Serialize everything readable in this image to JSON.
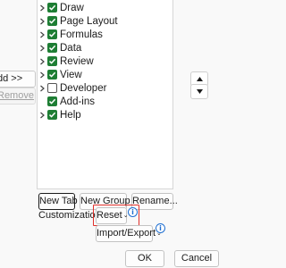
{
  "side_buttons": {
    "add_label": "dd >>",
    "remove_label": "Remove"
  },
  "tree": {
    "items": [
      {
        "label": "Draw",
        "checked": true,
        "expandable": true
      },
      {
        "label": "Page Layout",
        "checked": true,
        "expandable": true
      },
      {
        "label": "Formulas",
        "checked": true,
        "expandable": true
      },
      {
        "label": "Data",
        "checked": true,
        "expandable": true
      },
      {
        "label": "Review",
        "checked": true,
        "expandable": true
      },
      {
        "label": "View",
        "checked": true,
        "expandable": true
      },
      {
        "label": "Developer",
        "checked": false,
        "expandable": true
      },
      {
        "label": "Add-ins",
        "checked": true,
        "expandable": false
      },
      {
        "label": "Help",
        "checked": true,
        "expandable": true
      }
    ]
  },
  "buttons": {
    "new_tab": "New Tab",
    "new_group": "New Group",
    "rename": "Rename...",
    "reset": "Reset",
    "import_export": "Import/Export",
    "ok": "OK",
    "cancel": "Cancel"
  },
  "customizations_label": "Customizations:",
  "colors": {
    "checkbox_green": "#1e7e34",
    "highlight_red": "#e0302a",
    "info_blue": "#1f6fd1"
  }
}
